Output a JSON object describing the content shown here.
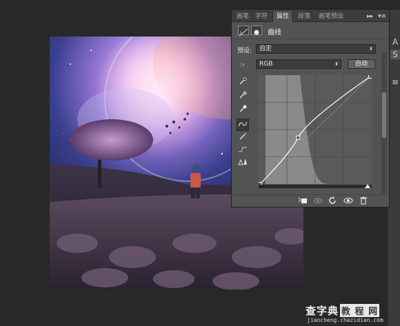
{
  "panel": {
    "tabs": [
      "画笔",
      "字符",
      "属性",
      "段落",
      "画笔预设"
    ],
    "active_tab": "属性",
    "tab_controls": {
      "collapse": "▸▸",
      "menu": "▾≡"
    },
    "adjustment_title": "曲线",
    "preset_label": "预设:",
    "preset_value": "自定",
    "channel_value": "RGB",
    "auto_button": "自动",
    "curve_tools": [
      "sample-in-image-black-icon",
      "sample-in-image-gray-icon",
      "sample-in-image-white-icon",
      "edit-points-curve-icon",
      "draw-curve-icon",
      "smooth-curve-icon",
      "clipping-warning-icon"
    ],
    "footer_icons": [
      "clip-to-layer-icon",
      "view-previous-state-icon",
      "reset-icon",
      "toggle-visibility-icon",
      "delete-icon"
    ]
  },
  "edge_strip": [
    "A",
    "S",
    "≡"
  ],
  "colors": {
    "panel_bg": "#535353",
    "tabbar_bg": "#3d3d3d",
    "workspace_bg": "#282828",
    "histogram": "#8a8a8a",
    "curve": "#ffffff"
  },
  "curve": {
    "points": [
      [
        0,
        0
      ],
      [
        88,
        110
      ],
      [
        255,
        255
      ]
    ]
  },
  "watermark": {
    "main_left": "查字典",
    "main_box": "教 程 网",
    "url": "jiaocheng.chazidian.com"
  }
}
